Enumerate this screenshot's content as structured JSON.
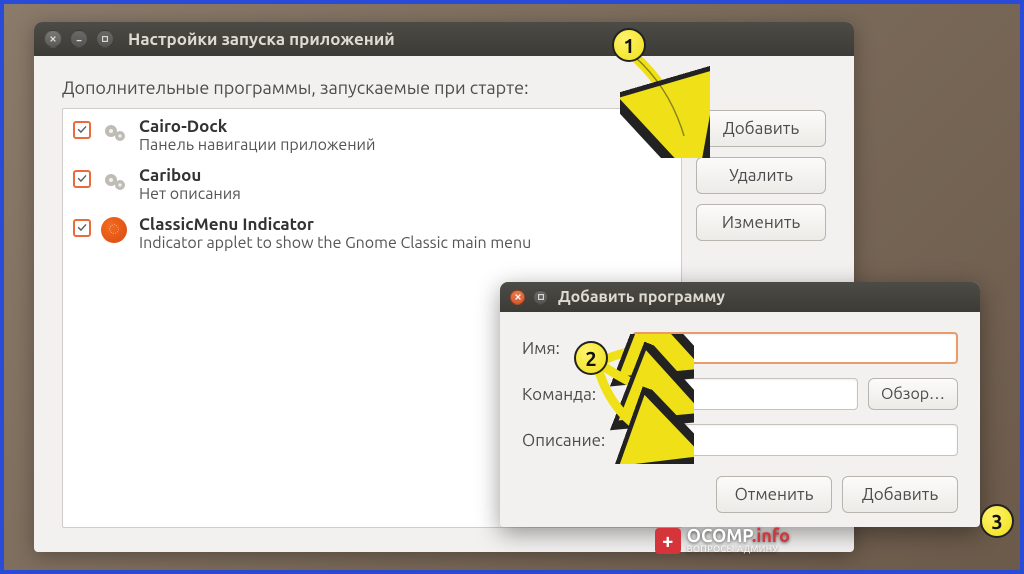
{
  "main_window": {
    "title": "Настройки запуска приложений",
    "section_label": "Дополнительные программы, запускаемые при старте:",
    "buttons": {
      "add": "Добавить",
      "remove": "Удалить",
      "edit": "Изменить"
    },
    "items": [
      {
        "checked": true,
        "icon": "gears",
        "name": "Cairo-Dock",
        "desc": "Панель навигации приложений"
      },
      {
        "checked": true,
        "icon": "gears",
        "name": "Caribou",
        "desc": "Нет описания"
      },
      {
        "checked": true,
        "icon": "ubuntu",
        "name": "ClassicMenu Indicator",
        "desc": "Indicator applet to show the Gnome Classic main menu"
      }
    ]
  },
  "dialog": {
    "title": "Добавить программу",
    "labels": {
      "name": "Имя:",
      "command": "Команда:",
      "comment": "Описание:"
    },
    "browse": "Обзор…",
    "actions": {
      "cancel": "Отменить",
      "add": "Добавить"
    },
    "values": {
      "name": "",
      "command": "",
      "comment": ""
    }
  },
  "callouts": {
    "one": "1",
    "two": "2",
    "three": "3"
  },
  "watermark": {
    "main": "OCOMP",
    "suffix": ".info",
    "sub": "ВОПРОСЫ АДМИНУ"
  }
}
